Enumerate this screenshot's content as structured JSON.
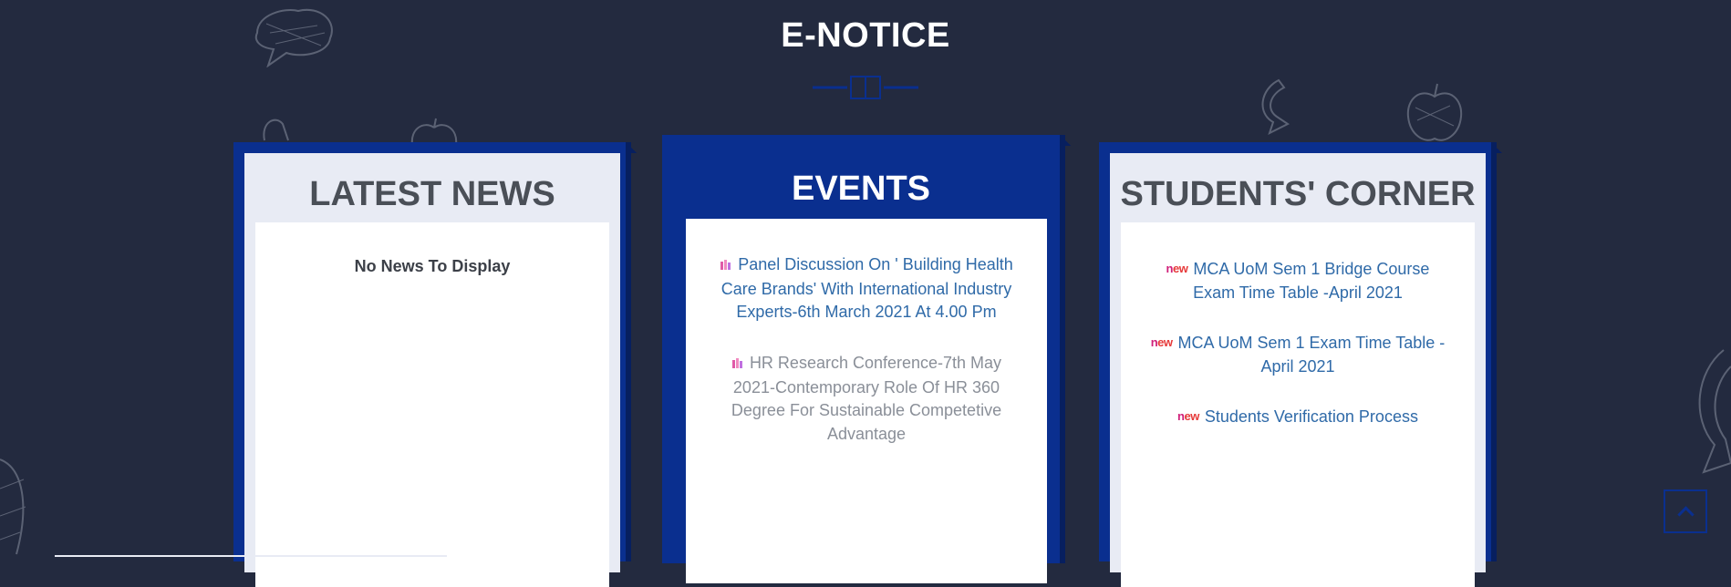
{
  "section": {
    "title": "E-NOTICE"
  },
  "latest_news": {
    "title": "LATEST NEWS",
    "empty_message": "No News To Display"
  },
  "events": {
    "title": "EVENTS",
    "items": [
      {
        "text": "Panel Discussion On ' Building Health Care Brands' With International Industry Experts-6th March 2021 At 4.00 Pm"
      },
      {
        "text": "HR Research Conference-7th May 2021-Contemporary Role Of HR 360 Degree For Sustainable Competetive Advantage"
      }
    ]
  },
  "students_corner": {
    "title": "STUDENTS' CORNER",
    "badge": "new",
    "items": [
      {
        "text": "MCA UoM Sem 1 Bridge Course Exam Time Table -April 2021"
      },
      {
        "text": "MCA UoM Sem 1 Exam Time Table - April 2021"
      },
      {
        "text": "Students Verification Process"
      }
    ]
  },
  "colors": {
    "background": "#232a3f",
    "card_blue": "#0a2f8f",
    "link": "#2f6aa8"
  }
}
